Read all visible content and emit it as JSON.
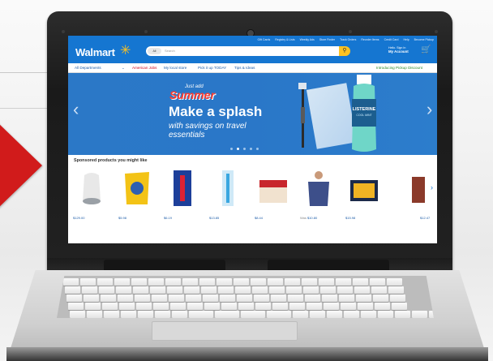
{
  "site": {
    "logo": "Walmart",
    "spark_glyph": "✳",
    "top_links": [
      "Gift Cards",
      "Registry & Lists",
      "Weekly Ads",
      "Store Finder",
      "Track Orders",
      "Reorder Items",
      "Credit Card",
      "Help",
      "Become Pickup"
    ],
    "search": {
      "department": "All",
      "placeholder": "Search",
      "button_icon": "search-icon"
    },
    "account": {
      "line1": "Hello. Sign In",
      "line2": "My Account"
    },
    "cart_icon": "cart-icon",
    "subnav": {
      "departments": "All Departments",
      "promo": "American Jobs",
      "links": [
        "My local store",
        "Pick it up TODAY",
        "Tips & Ideas"
      ],
      "right": "Introducing Pickup Discount"
    },
    "colors": {
      "brand_blue": "#1576d1",
      "spark_yellow": "#ffc220",
      "promo_red": "#d0021b"
    }
  },
  "hero": {
    "kicker": "Just add",
    "headline_accent": "Summer",
    "headline": "Make a splash",
    "subline": "with savings on travel essentials",
    "bottle_label": "LISTERINE",
    "bottle_sub": "COOL MINT",
    "dots_total": 5,
    "active_dot": 1
  },
  "sponsored": {
    "title": "Sponsored products you might like",
    "products": [
      {
        "name": "smart-speaker",
        "price": "$129.00",
        "old": ""
      },
      {
        "name": "snack-bag",
        "price": "$5.98",
        "old": ""
      },
      {
        "name": "razor-pack",
        "price": "$6.19",
        "old": ""
      },
      {
        "name": "toothbrush-pack",
        "price": "$13.85",
        "old": ""
      },
      {
        "name": "nutrition-shakes",
        "price": "$8.44",
        "old": ""
      },
      {
        "name": "t-shirt",
        "price": "$10.80",
        "old": "Was"
      },
      {
        "name": "lego-set",
        "price": "$15.98",
        "old": ""
      },
      {
        "name": "cropped-item",
        "price": "$12.47",
        "old": ""
      }
    ]
  }
}
